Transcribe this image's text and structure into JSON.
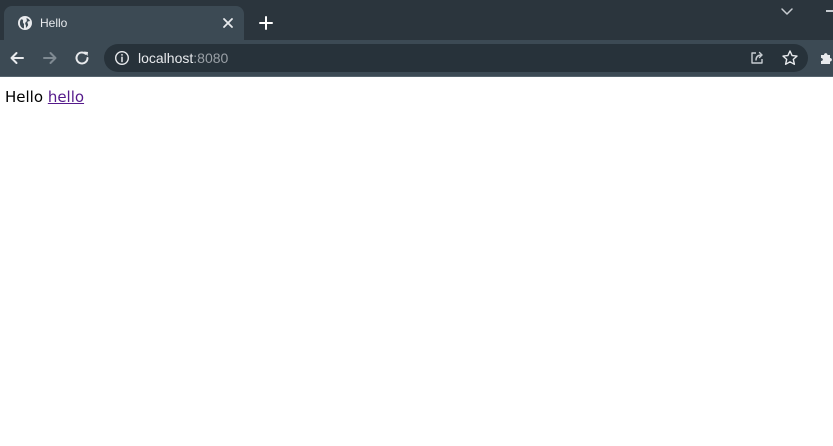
{
  "tab": {
    "title": "Hello",
    "favicon": "globe-icon"
  },
  "toolbar": {
    "back": "back-arrow-icon",
    "forward": "forward-arrow-icon",
    "reload": "reload-icon"
  },
  "omnibox": {
    "host": "localhost",
    "port": ":8080"
  },
  "page": {
    "text": "Hello",
    "link": "hello"
  },
  "colors": {
    "tabstrip": "#2b353d",
    "toolbar": "#3c4a54",
    "omnibox": "#27323a",
    "visited_link": "#551a8b"
  }
}
